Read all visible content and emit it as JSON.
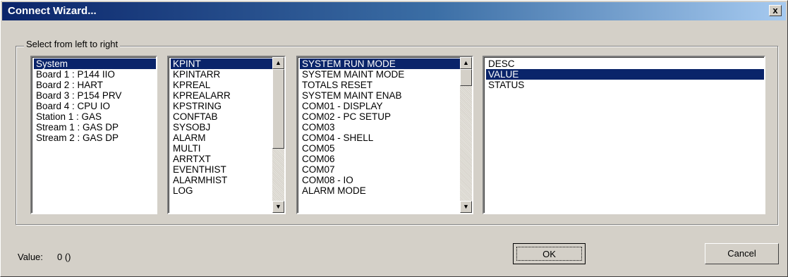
{
  "window": {
    "title": "Connect Wizard...",
    "close_glyph": "x"
  },
  "group": {
    "label": "Select from left to right"
  },
  "list1": {
    "items": [
      "System",
      "Board 1 : P144 IIO",
      "Board 2 : HART",
      "Board 3 : P154 PRV",
      "Board 4 : CPU IO",
      "Station 1 : GAS",
      "Stream 1 : GAS DP",
      "Stream 2 : GAS DP"
    ],
    "selected_index": 0
  },
  "list2": {
    "items": [
      "KPINT",
      "KPINTARR",
      "KPREAL",
      "KPREALARR",
      "KPSTRING",
      "CONFTAB",
      "SYSOBJ",
      "ALARM",
      "MULTI",
      "ARRTXT",
      "EVENTHIST",
      "ALARMHIST",
      "LOG"
    ],
    "selected_index": 0
  },
  "list3": {
    "items": [
      "SYSTEM RUN MODE",
      "SYSTEM MAINT MODE",
      "TOTALS RESET",
      "SYSTEM MAINT ENAB",
      "COM01 - DISPLAY",
      "COM02 - PC SETUP",
      "COM03",
      "COM04 - SHELL",
      "COM05",
      "COM06",
      "COM07",
      "COM08 - IO",
      "ALARM MODE"
    ],
    "selected_index": 0
  },
  "list4": {
    "items": [
      "DESC",
      "VALUE",
      "STATUS"
    ],
    "selected_index": 1
  },
  "scroll_icons": {
    "up": "▲",
    "down": "▼"
  },
  "footer": {
    "value_label": "Value:",
    "value_text": "0 ()",
    "ok_label": "OK",
    "cancel_label": "Cancel"
  }
}
